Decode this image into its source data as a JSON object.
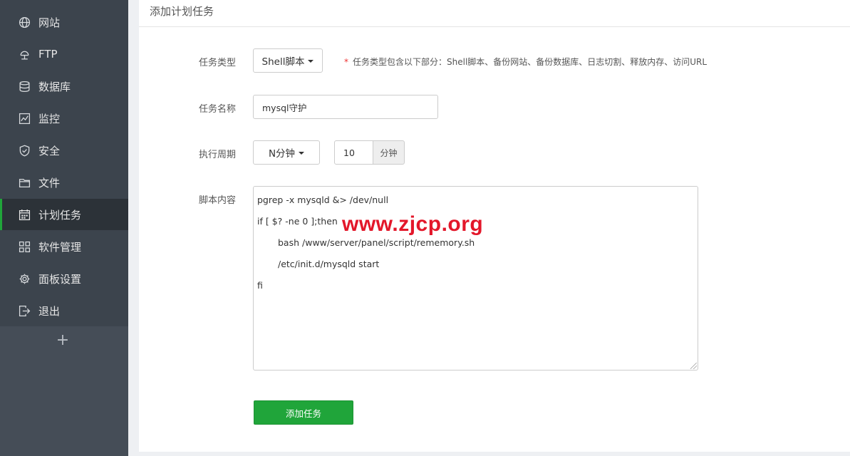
{
  "sidebar": {
    "items": [
      {
        "label": "网站",
        "icon": "globe-icon"
      },
      {
        "label": "FTP",
        "icon": "ftp-icon"
      },
      {
        "label": "数据库",
        "icon": "database-icon"
      },
      {
        "label": "监控",
        "icon": "monitor-icon"
      },
      {
        "label": "安全",
        "icon": "shield-icon"
      },
      {
        "label": "文件",
        "icon": "folder-icon"
      },
      {
        "label": "计划任务",
        "icon": "calendar-icon",
        "active": true
      },
      {
        "label": "软件管理",
        "icon": "grid-icon"
      },
      {
        "label": "面板设置",
        "icon": "gear-icon"
      },
      {
        "label": "退出",
        "icon": "logout-icon"
      }
    ],
    "add_label": "+"
  },
  "panel": {
    "title": "添加计划任务"
  },
  "form": {
    "task_type": {
      "label": "任务类型",
      "value": "Shell脚本",
      "hint_star": "*",
      "hint": "任务类型包含以下部分：Shell脚本、备份网站、备份数据库、日志切割、释放内存、访问URL"
    },
    "task_name": {
      "label": "任务名称",
      "value": "mysql守护"
    },
    "period": {
      "label": "执行周期",
      "mode": "N分钟",
      "value": "10",
      "unit": "分钟"
    },
    "script": {
      "label": "脚本内容",
      "lines": [
        "pgrep -x mysqld &> /dev/null",
        "if [ $? -ne 0 ];then",
        "bash /www/server/panel/script/rememory.sh",
        "/etc/init.d/mysqld start",
        "fi"
      ]
    },
    "submit_label": "添加任务"
  },
  "watermark": "www.zjcp.org",
  "colors": {
    "sidebar_bg": "#3c444d",
    "active_bar": "#20a53a",
    "button_green": "#20a53a",
    "watermark_red": "#e3172a"
  }
}
